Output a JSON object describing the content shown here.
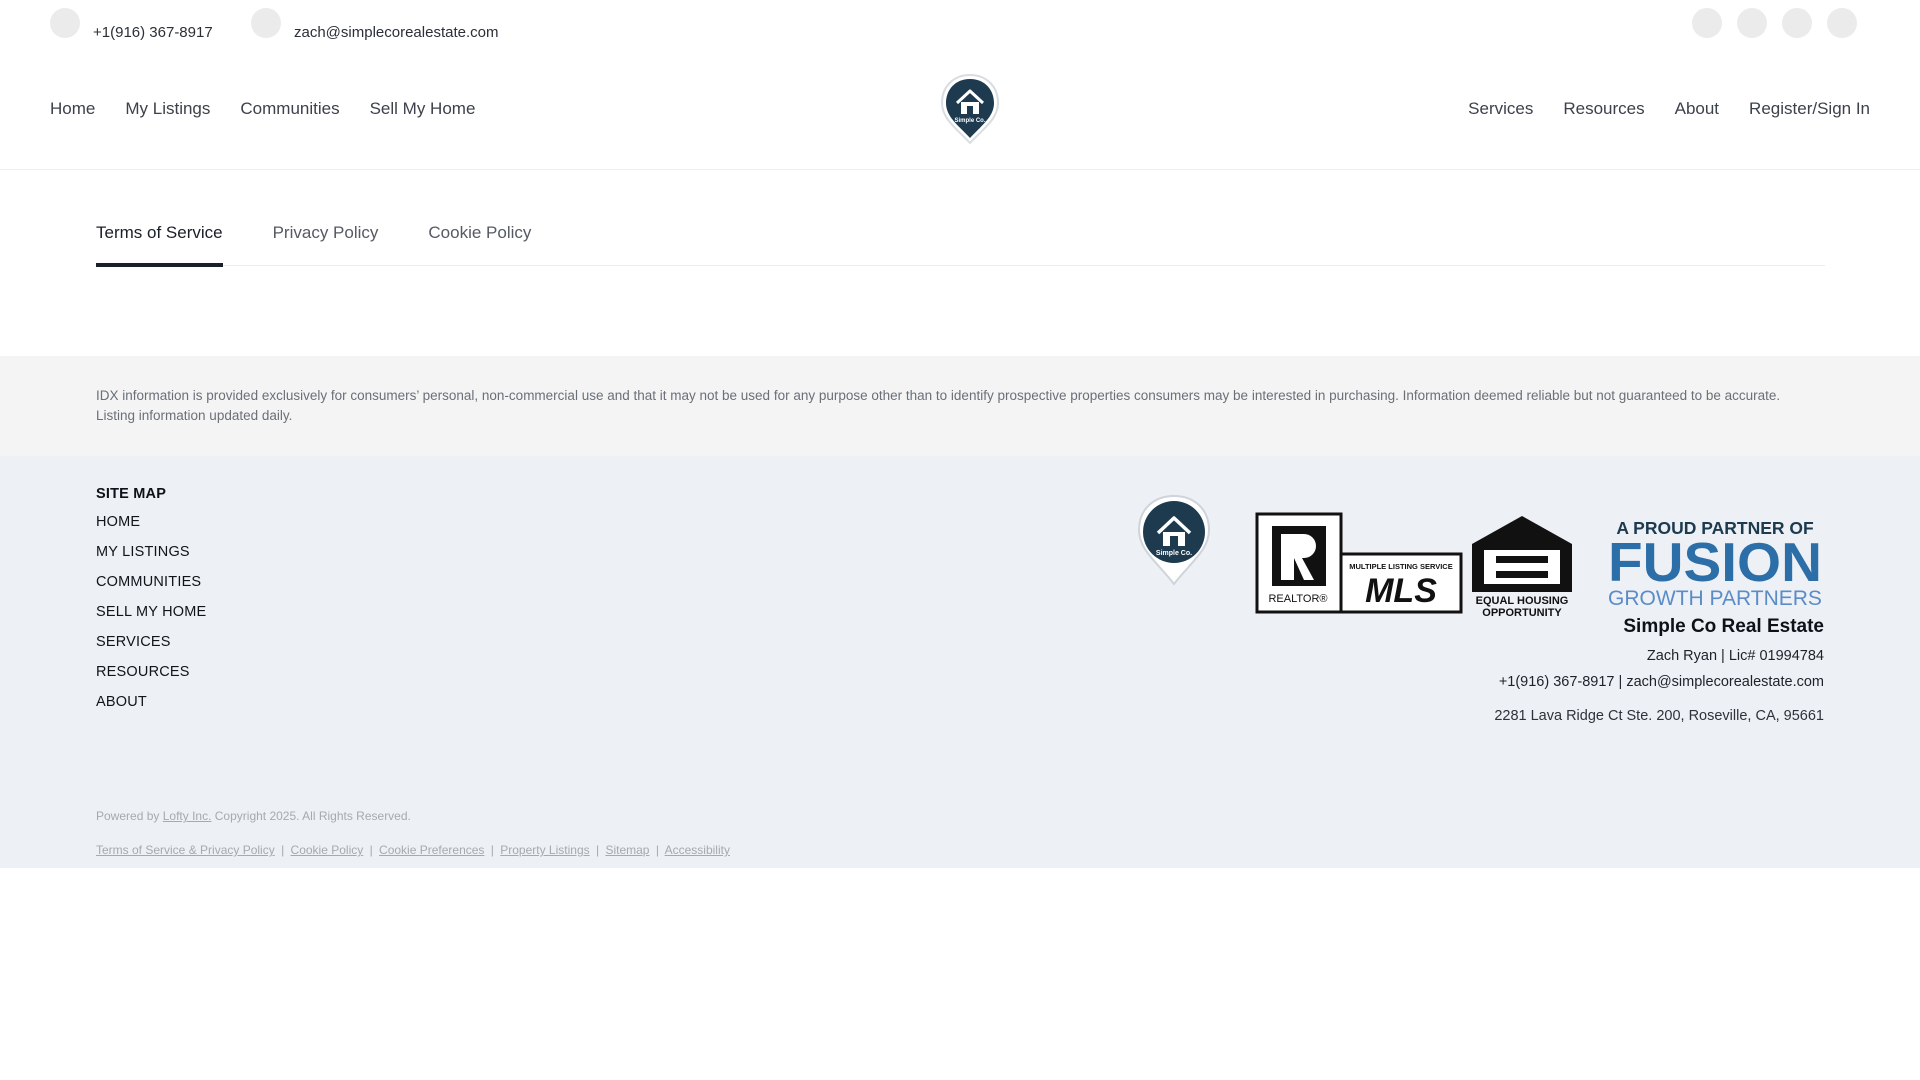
{
  "topbar": {
    "phone": "+1(916) 367-8917",
    "email": "zach@simplecorealestate.com",
    "phone_icon": "phone-icon",
    "email_icon": "mail-icon",
    "socials": [
      "facebook-icon",
      "instagram-icon",
      "linkedin-icon",
      "youtube-icon"
    ]
  },
  "nav": {
    "left": [
      "Home",
      "My Listings",
      "Communities",
      "Sell My Home"
    ],
    "right": [
      "Services",
      "Resources",
      "About",
      "Register/Sign In"
    ],
    "logo_text": "Simple Co."
  },
  "tabs": {
    "items": [
      "Terms of Service",
      "Privacy Policy",
      "Cookie Policy"
    ],
    "active": "Terms of Service"
  },
  "disclaimer": "IDX information is provided exclusively for consumers’ personal, non-commercial use and that it may not be used for any purpose other than to identify prospective properties consumers may be interested in purchasing. Information deemed reliable but not guaranteed to be accurate. Listing information updated daily.",
  "footer": {
    "sitemap_title": "SITE MAP",
    "sitemap": [
      "HOME",
      "MY LISTINGS",
      "COMMUNITIES",
      "SELL MY HOME",
      "SERVICES",
      "RESOURCES",
      "ABOUT"
    ],
    "logos": {
      "realtor": "REALTOR®",
      "mls_sub": "MULTIPLE LISTING SERVICE",
      "mls": "MLS",
      "eho1": "EQUAL HOUSING",
      "eho2": "OPPORTUNITY",
      "fusion_top": "A PROUD PARTNER OF",
      "fusion_mid": "FUSION",
      "fusion_bot": "GROWTH PARTNERS"
    },
    "company": "Simple Co Real Estate",
    "agent_line": "Zach Ryan  |  Lic# 01994784",
    "contact_line": "+1(916) 367-8917  |  zach@simplecorealestate.com",
    "address": "2281 Lava Ridge Ct Ste. 200, Roseville, CA, 95661",
    "powered_prefix": "Powered by",
    "powered_link": "Lofty Inc.",
    "copyright": "Copyright 2025. All Rights Reserved.",
    "legal_links": [
      "Terms of Service & Privacy Policy",
      "Cookie Policy",
      "Cookie Preferences",
      "Property Listings",
      "Sitemap",
      "Accessibility"
    ],
    "legal_sep": "|"
  },
  "colors": {
    "brand_navy": "#1d3a4f",
    "fusion_blue": "#2b6ea8",
    "fusion_light": "#5b8cc8"
  }
}
